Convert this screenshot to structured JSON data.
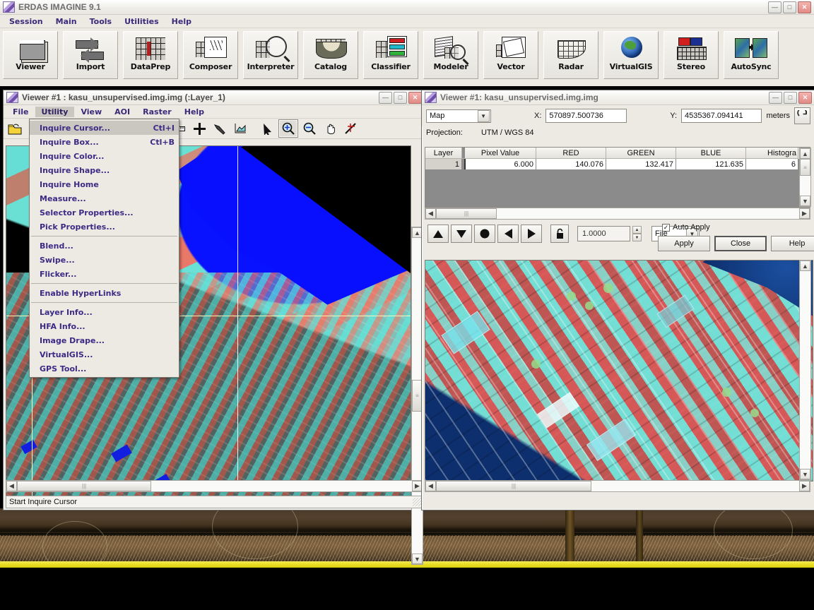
{
  "app": {
    "title": "ERDAS IMAGINE 9.1",
    "menus": [
      "Session",
      "Main",
      "Tools",
      "Utilities",
      "Help"
    ],
    "toolbar": [
      {
        "label": "Viewer",
        "icon": "viewer-icon"
      },
      {
        "label": "Import",
        "icon": "import-arrows-icon"
      },
      {
        "label": "DataPrep",
        "icon": "dataprep-grid-icon"
      },
      {
        "label": "Composer",
        "icon": "composer-map-icon"
      },
      {
        "label": "Interpreter",
        "icon": "interpreter-magnifier-icon"
      },
      {
        "label": "Catalog",
        "icon": "catalog-basket-icon"
      },
      {
        "label": "Classifier",
        "icon": "classifier-legend-icon"
      },
      {
        "label": "Modeler",
        "icon": "modeler-stack-icon"
      },
      {
        "label": "Vector",
        "icon": "vector-polygon-icon"
      },
      {
        "label": "Radar",
        "icon": "radar-fan-icon"
      },
      {
        "label": "VirtualGIS",
        "icon": "globe-icon"
      },
      {
        "label": "Stereo",
        "icon": "stereo-anaglyph-icon"
      },
      {
        "label": "AutoSync",
        "icon": "autosync-icon"
      }
    ],
    "window_controls": {
      "minimize": "—",
      "maximize": "□",
      "close": "✕"
    }
  },
  "viewer_left": {
    "title": "Viewer #1 : kasu_unsupervised.img.img (:Layer_1)",
    "menus": [
      "File",
      "Utility",
      "View",
      "AOI",
      "Raster",
      "Help"
    ],
    "open_menu": "Utility",
    "toolbar_icons": [
      "open-folder-icon",
      "measure-ruler-icon",
      "add-crosshair-icon",
      "hammer-icon",
      "profile-chart-icon",
      "arrow-pointer-icon",
      "zoom-in-icon",
      "zoom-out-icon",
      "pan-hand-icon",
      "inquire-cursor-icon"
    ],
    "selected_tool": "zoom-in-icon",
    "status": "Start Inquire Cursor"
  },
  "utility_menu": {
    "items": [
      {
        "label": "Inquire Cursor...",
        "accel": "Ctl+I",
        "highlighted": true
      },
      {
        "label": "Inquire Box...",
        "accel": "Ctl+B",
        "highlighted": false
      },
      {
        "label": "Inquire Color...",
        "accel": "",
        "highlighted": false
      },
      {
        "label": "Inquire Shape...",
        "accel": "",
        "highlighted": false
      },
      {
        "label": "Inquire Home",
        "accel": "",
        "highlighted": false
      },
      {
        "label": "Measure...",
        "accel": "",
        "highlighted": false
      },
      {
        "label": "Selector Properties...",
        "accel": "",
        "highlighted": false
      },
      {
        "label": "Pick Properties...",
        "accel": "",
        "highlighted": false
      },
      {
        "separator": true
      },
      {
        "label": "Blend...",
        "accel": "",
        "highlighted": false
      },
      {
        "label": "Swipe...",
        "accel": "",
        "highlighted": false
      },
      {
        "label": "Flicker...",
        "accel": "",
        "highlighted": false
      },
      {
        "separator": true
      },
      {
        "label": "Enable HyperLinks",
        "accel": "",
        "highlighted": false
      },
      {
        "separator": true
      },
      {
        "label": "Layer Info...",
        "accel": "",
        "highlighted": false
      },
      {
        "label": "HFA Info...",
        "accel": "",
        "highlighted": false
      },
      {
        "label": "Image Drape...",
        "accel": "",
        "highlighted": false
      },
      {
        "label": "VirtualGIS...",
        "accel": "",
        "highlighted": false
      },
      {
        "label": "GPS Tool...",
        "accel": "",
        "highlighted": false
      }
    ]
  },
  "inquire_cursor": {
    "title": "Viewer #1:  kasu_unsupervised.img.img",
    "coord_type": "Map",
    "x_label": "X:",
    "x_value": "570897.500736",
    "y_label": "Y:",
    "y_value": "4535367.094141",
    "units": "meters",
    "refresh_icon": "refresh-icon",
    "projection_label": "Projection:",
    "projection_value": "UTM / WGS 84",
    "table": {
      "headers": [
        "Layer",
        "Pixel Value",
        "RED",
        "GREEN",
        "BLUE",
        "Histogra"
      ],
      "rows": [
        {
          "layer": "1",
          "pixel_value": "6.000",
          "red": "140.076",
          "green": "132.417",
          "blue": "121.635",
          "histogram": "6"
        }
      ]
    },
    "nav_buttons": [
      {
        "name": "nav-up-button",
        "glyph": "▲"
      },
      {
        "name": "nav-down-button",
        "glyph": "▼"
      },
      {
        "name": "nav-center-button",
        "glyph": "●"
      },
      {
        "name": "nav-left-button",
        "glyph": "◀"
      },
      {
        "name": "nav-right-button",
        "glyph": "▶"
      }
    ],
    "lock_icon": "lock-icon",
    "step_value": "1.0000",
    "units_select": "File",
    "auto_apply_label": "Auto Apply",
    "auto_apply_checked": "✓",
    "apply_label": "Apply",
    "close_label": "Close",
    "help_label": "Help"
  },
  "colors": {
    "window_face": "#eceae3",
    "menu_text": "#3b2b86",
    "title_text": "#6d6d6d",
    "water_blue": "#0a10f2",
    "veg_red": "#e0796a",
    "urban_cyan": "#6fdcd4",
    "highlight": "#c9c7c0",
    "wallpaper_stripe": "#e9dd22"
  }
}
